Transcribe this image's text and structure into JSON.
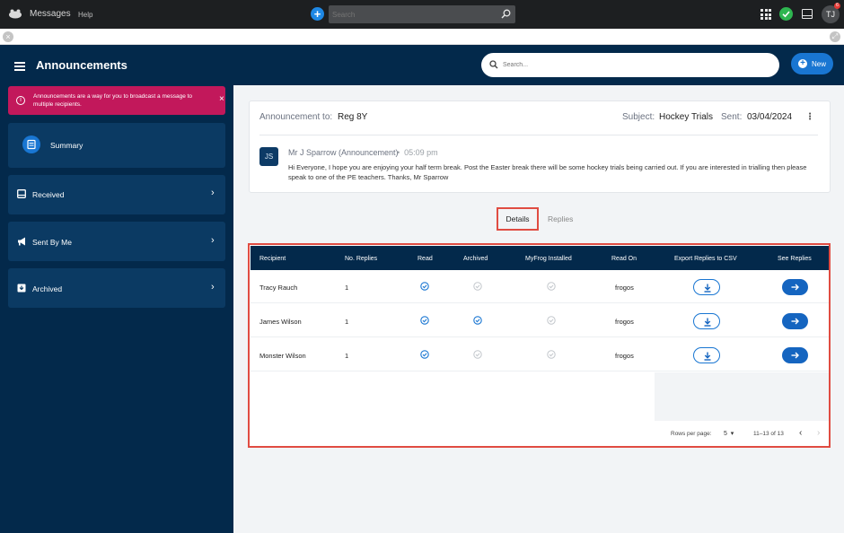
{
  "topbar": {
    "app_title": "Messages",
    "help": "Help",
    "search_placeholder": "Search",
    "avatar_initials": "TJ",
    "notification_count": "6"
  },
  "header": {
    "title": "Announcements",
    "search_placeholder": "Search...",
    "new_label": "New"
  },
  "sidebar": {
    "notice": "Announcements are a way for you to broadcast a message to multiple recipients.",
    "items": [
      {
        "label": "Summary"
      },
      {
        "label": "Received"
      },
      {
        "label": "Sent By Me"
      },
      {
        "label": "Archived"
      }
    ]
  },
  "announcement": {
    "to_label": "Announcement to:",
    "to_value": "Reg 8Y",
    "subject_label": "Subject:",
    "subject_value": "Hockey Trials",
    "sent_label": "Sent:",
    "sent_value": "03/04/2024",
    "sender_initials": "JS",
    "sender": "Mr J Sparrow (Announcement)",
    "time": "05:09 pm",
    "message": "Hi Everyone, I hope you are enjoying your half term break. Post the Easter break there will be some hockey trials being carried out. If you are interested in trialling then please speak to one of the PE teachers. Thanks, Mr Sparrow"
  },
  "tabs": [
    {
      "label": "Details",
      "active": true
    },
    {
      "label": "Replies",
      "active": false
    }
  ],
  "table": {
    "headers": [
      "Recipient",
      "No. Replies",
      "Read",
      "Archived",
      "MyFrog Installed",
      "Read On",
      "Export Replies to CSV",
      "See Replies"
    ],
    "rows": [
      {
        "recipient": "Tracy Rauch",
        "replies": "1",
        "read": true,
        "archived": false,
        "myfrog": false,
        "read_on": "frogos"
      },
      {
        "recipient": "James Wilson",
        "replies": "1",
        "read": true,
        "archived": true,
        "myfrog": false,
        "read_on": "frogos"
      },
      {
        "recipient": "Monster Wilson",
        "replies": "1",
        "read": true,
        "archived": false,
        "myfrog": false,
        "read_on": "frogos"
      }
    ],
    "rows_per_page_label": "Rows per page:",
    "rows_per_page_value": "5",
    "range": "11–13 of 13"
  },
  "colors": {
    "navy": "#03294b",
    "accent": "#1976d2",
    "pink": "#c2185b",
    "highlight": "#e04c42"
  }
}
